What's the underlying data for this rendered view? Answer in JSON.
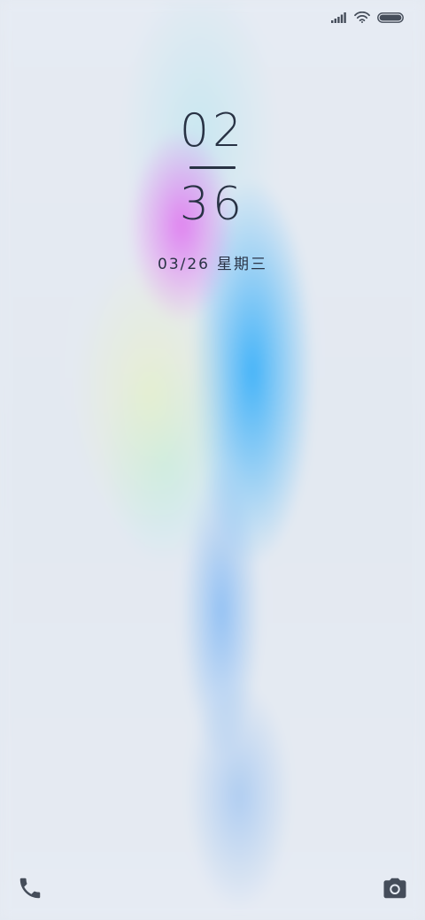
{
  "status_bar": {
    "signal_icon": "cellular-signal-icon",
    "wifi_icon": "wifi-icon",
    "battery_icon": "battery-icon",
    "battery_level": 1.0
  },
  "lockscreen": {
    "hour": "02",
    "minute": "36",
    "date": "03/26",
    "weekday": "星期三"
  },
  "shortcuts": {
    "left_icon": "phone-icon",
    "right_icon": "camera-icon"
  },
  "colors": {
    "text": "#283244",
    "icons": "#454d5a"
  }
}
